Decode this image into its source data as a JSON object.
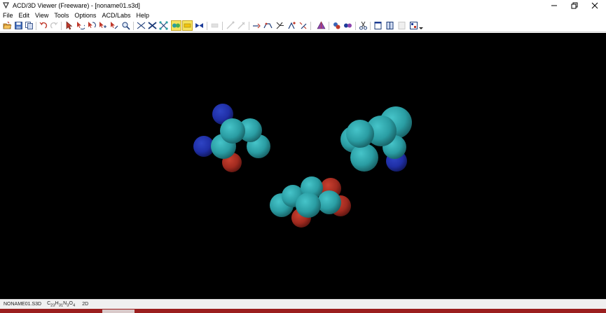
{
  "window": {
    "title": "ACD/3D Viewer (Freeware) - [noname01.s3d]",
    "app_icon": "acd-3d-viewer-icon",
    "controls": [
      "minimize-icon",
      "restore-icon",
      "close-icon"
    ]
  },
  "menu": {
    "items": [
      {
        "label": "File"
      },
      {
        "label": "Edit"
      },
      {
        "label": "View"
      },
      {
        "label": "Tools"
      },
      {
        "label": "Options"
      },
      {
        "label": "ACD/Labs"
      },
      {
        "label": "Help"
      }
    ]
  },
  "toolbar": {
    "buttons": [
      {
        "icon": "open-folder-icon"
      },
      {
        "icon": "save-icon"
      },
      {
        "icon": "copy-icon"
      },
      {
        "icon": "undo-icon"
      },
      {
        "icon": "redo-icon"
      },
      {
        "icon": "select-icon"
      },
      {
        "icon": "rotate-icon"
      },
      {
        "icon": "rotate-3d-icon"
      },
      {
        "icon": "move-icon"
      },
      {
        "icon": "move-3d-icon"
      },
      {
        "icon": "zoom-icon"
      },
      {
        "icon": "wireframe-icon"
      },
      {
        "icon": "sticks-icon"
      },
      {
        "icon": "ball-stick-icon"
      },
      {
        "icon": "spacefill-icon",
        "active": true
      },
      {
        "icon": "dots-icon",
        "active": true
      },
      {
        "icon": "ribbon-icon"
      },
      {
        "icon": "measure-disabled-icon",
        "disabled": true
      },
      {
        "icon": "distance-icon",
        "disabled": true
      },
      {
        "icon": "angle-icon",
        "disabled": true
      },
      {
        "icon": "bond-icon"
      },
      {
        "icon": "torsion-icon"
      },
      {
        "icon": "stereo-icon"
      },
      {
        "icon": "labels-icon"
      },
      {
        "icon": "optimize-icon"
      },
      {
        "icon": "pyramid-icon"
      },
      {
        "icon": "color-atoms-icon"
      },
      {
        "icon": "color-molecules-icon"
      },
      {
        "icon": "cut-icon"
      },
      {
        "icon": "window-icon"
      },
      {
        "icon": "split-window-icon"
      },
      {
        "icon": "tile-icon",
        "disabled": true
      },
      {
        "icon": "grid-icon"
      },
      {
        "icon": "dropdown-arrow-icon"
      }
    ]
  },
  "viewport": {
    "background": "#000000",
    "atom_colors": {
      "carbon": "#2a9da3",
      "nitrogen": "#1f2fa6",
      "oxygen": "#a12a1f"
    },
    "molecule_count": 3
  },
  "status": {
    "file": "NONAME01.S3D",
    "formula_parts": [
      {
        "text": "C",
        "sub": false
      },
      {
        "text": "23",
        "sub": true
      },
      {
        "text": "H",
        "sub": false
      },
      {
        "text": "31",
        "sub": true
      },
      {
        "text": "N",
        "sub": false
      },
      {
        "text": "3",
        "sub": true
      },
      {
        "text": "O",
        "sub": false
      },
      {
        "text": "4",
        "sub": true
      }
    ],
    "mode": "2D"
  }
}
